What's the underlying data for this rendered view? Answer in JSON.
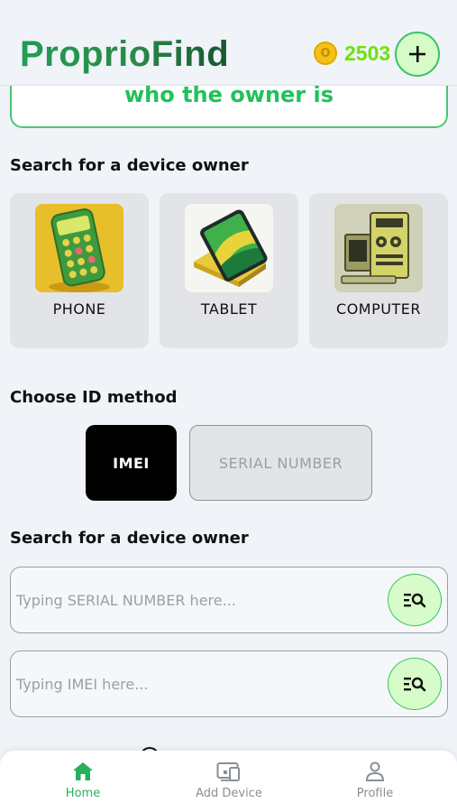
{
  "app": {
    "title": "ProprioFind",
    "coins": "2503",
    "coin_glyph": "O"
  },
  "banner": {
    "text": "who the owner is"
  },
  "device_section": {
    "title": "Search for a device owner",
    "devices": [
      {
        "label": "PHONE"
      },
      {
        "label": "TABLET"
      },
      {
        "label": "COMPUTER"
      }
    ]
  },
  "id_section": {
    "title": "Choose ID method",
    "options": [
      {
        "label": "IMEI",
        "selected": true
      },
      {
        "label": "SERIAL NUMBER",
        "selected": false
      }
    ]
  },
  "search_section": {
    "title": "Search for a device owner",
    "serial_placeholder": "Typing SERIAL NUMBER here...",
    "imei_placeholder": "Typing IMEI here..."
  },
  "nav": {
    "items": [
      {
        "label": "Home",
        "icon": "home-icon",
        "active": true
      },
      {
        "label": "Add Device",
        "icon": "devices-icon",
        "active": false
      },
      {
        "label": "Profile",
        "icon": "person-icon",
        "active": false
      }
    ]
  },
  "colors": {
    "accent": "#27b05c",
    "coins": "#6ee30b",
    "button_bg": "#d8fcc9"
  }
}
